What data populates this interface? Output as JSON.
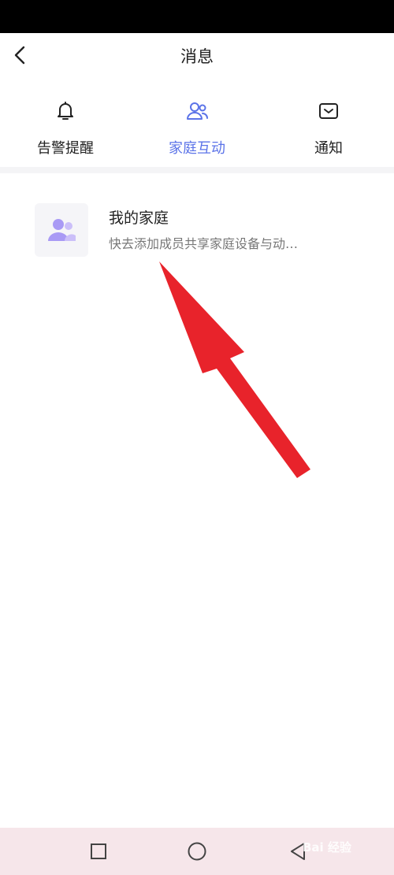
{
  "header": {
    "title": "消息"
  },
  "tabs": [
    {
      "label": "告警提醒",
      "icon": "bell-icon"
    },
    {
      "label": "家庭互动",
      "icon": "family-icon",
      "active": true
    },
    {
      "label": "通知",
      "icon": "notice-icon"
    }
  ],
  "messages": [
    {
      "title": "我的家庭",
      "description": "快去添加成员共享家庭设备与动…",
      "icon": "family-group-icon"
    }
  ],
  "watermark": {
    "text": "Bai 经验"
  },
  "colors": {
    "accent": "#5b73e8",
    "arrow": "#e8232b",
    "navbar": "#f6e6ea"
  }
}
